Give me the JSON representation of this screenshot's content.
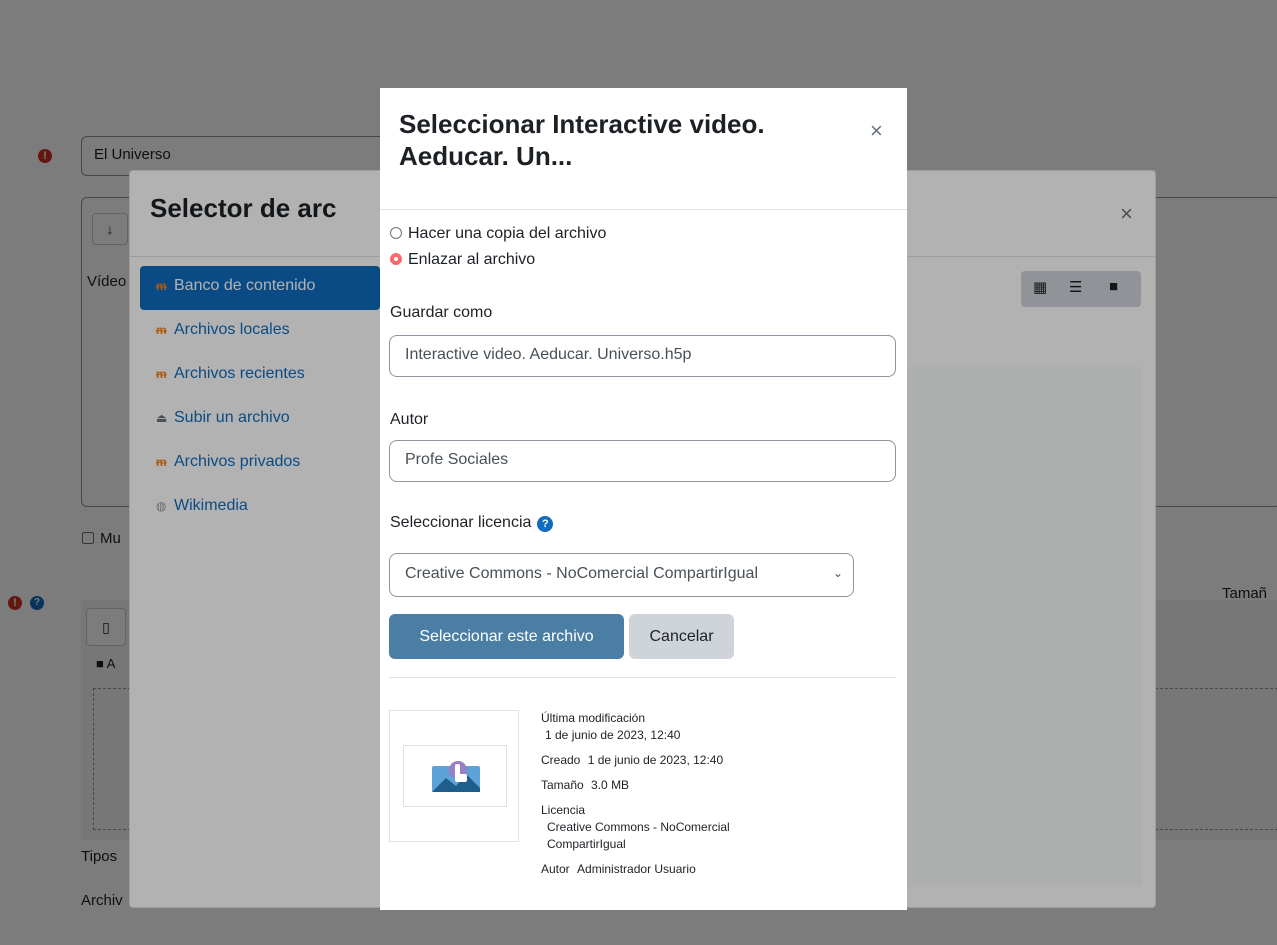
{
  "background": {
    "name_value": "El Universo",
    "editor_label": "Vídeo",
    "checkbox_label": "Mu",
    "size_label": "Tamañ",
    "fm_path": "A",
    "tipos_label": "Tipos",
    "archiv_label": "Archiv",
    "req_icon": "!",
    "help_icon": "?",
    "editor_toolbar_icon": "↓",
    "fm_file_icon": "▯"
  },
  "picker": {
    "title": "Selector de arc",
    "close": "×",
    "repositories": [
      {
        "label": "Banco de contenido",
        "icon": "moodle-icon"
      },
      {
        "label": "Archivos locales",
        "icon": "moodle-icon"
      },
      {
        "label": "Archivos recientes",
        "icon": "moodle-icon"
      },
      {
        "label": "Subir un archivo",
        "icon": "upload-icon"
      },
      {
        "label": "Archivos privados",
        "icon": "moodle-icon"
      },
      {
        "label": "Wikimedia",
        "icon": "wikimedia-icon"
      }
    ],
    "view_icons": [
      "grid-icon",
      "list-icon",
      "folder-icon"
    ]
  },
  "dialog": {
    "title": "Seleccionar Interactive video. Aeducar. Un...",
    "close": "×",
    "radio_copy": "Hacer una copia del archivo",
    "radio_link": "Enlazar al archivo",
    "save_as_label": "Guardar como",
    "save_as_value": "Interactive video. Aeducar. Universo.h5p",
    "author_label": "Autor",
    "author_value": "Profe Sociales",
    "license_label": "Seleccionar licencia",
    "license_value": "Creative Commons - NoComercial CompartirIgual",
    "select_button": "Seleccionar este archivo",
    "cancel_button": "Cancelar",
    "info": {
      "modified_label": "Última modificación",
      "modified_value": "1 de junio de 2023, 12:40",
      "created_label": "Creado",
      "created_value": "1 de junio de 2023, 12:40",
      "size_label": "Tamaño",
      "size_value": "3.0 MB",
      "license_label": "Licencia",
      "license_value_1": "Creative Commons - NoComercial",
      "license_value_2": "CompartirIgual",
      "author_label": "Autor",
      "author_value": "Administrador Usuario"
    }
  },
  "colors": {
    "primary": "#0f6cbf",
    "button_primary": "#4a7ea5",
    "danger": "#ca3120",
    "radio_checked": "#fd6a6a"
  }
}
